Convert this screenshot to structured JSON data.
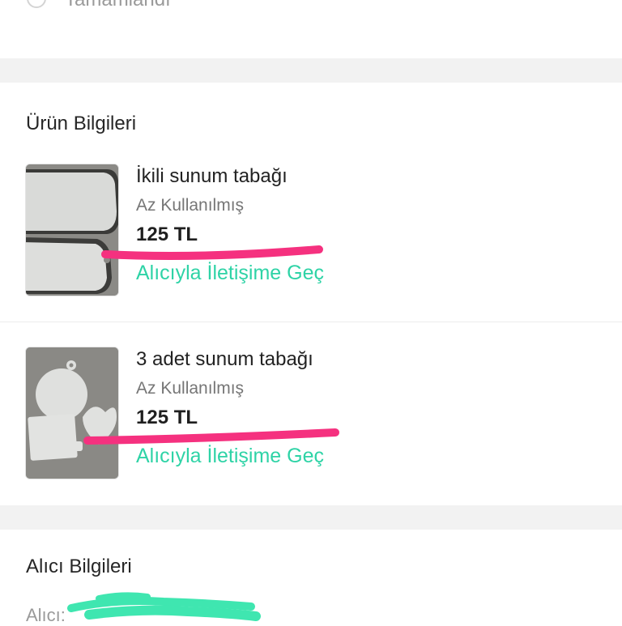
{
  "status": {
    "label": "Tamamlandı"
  },
  "product_section": {
    "title": "Ürün Bilgileri"
  },
  "products": [
    {
      "title": "İkili sunum tabağı",
      "condition": "Az Kullanılmış",
      "price": "125 TL",
      "contact_label": "Alıcıyla İletişime Geç"
    },
    {
      "title": "3 adet sunum tabağı",
      "condition": "Az Kullanılmış",
      "price": "125 TL",
      "contact_label": "Alıcıyla İletişime Geç"
    }
  ],
  "buyer_section": {
    "title": "Alıcı Bilgileri",
    "buyer_label": "Alıcı:"
  },
  "colors": {
    "accent": "#2ed3a6",
    "highlight_pink": "#f5317f",
    "highlight_green": "#3fe6b0",
    "section_gap": "#f2f2f2"
  }
}
